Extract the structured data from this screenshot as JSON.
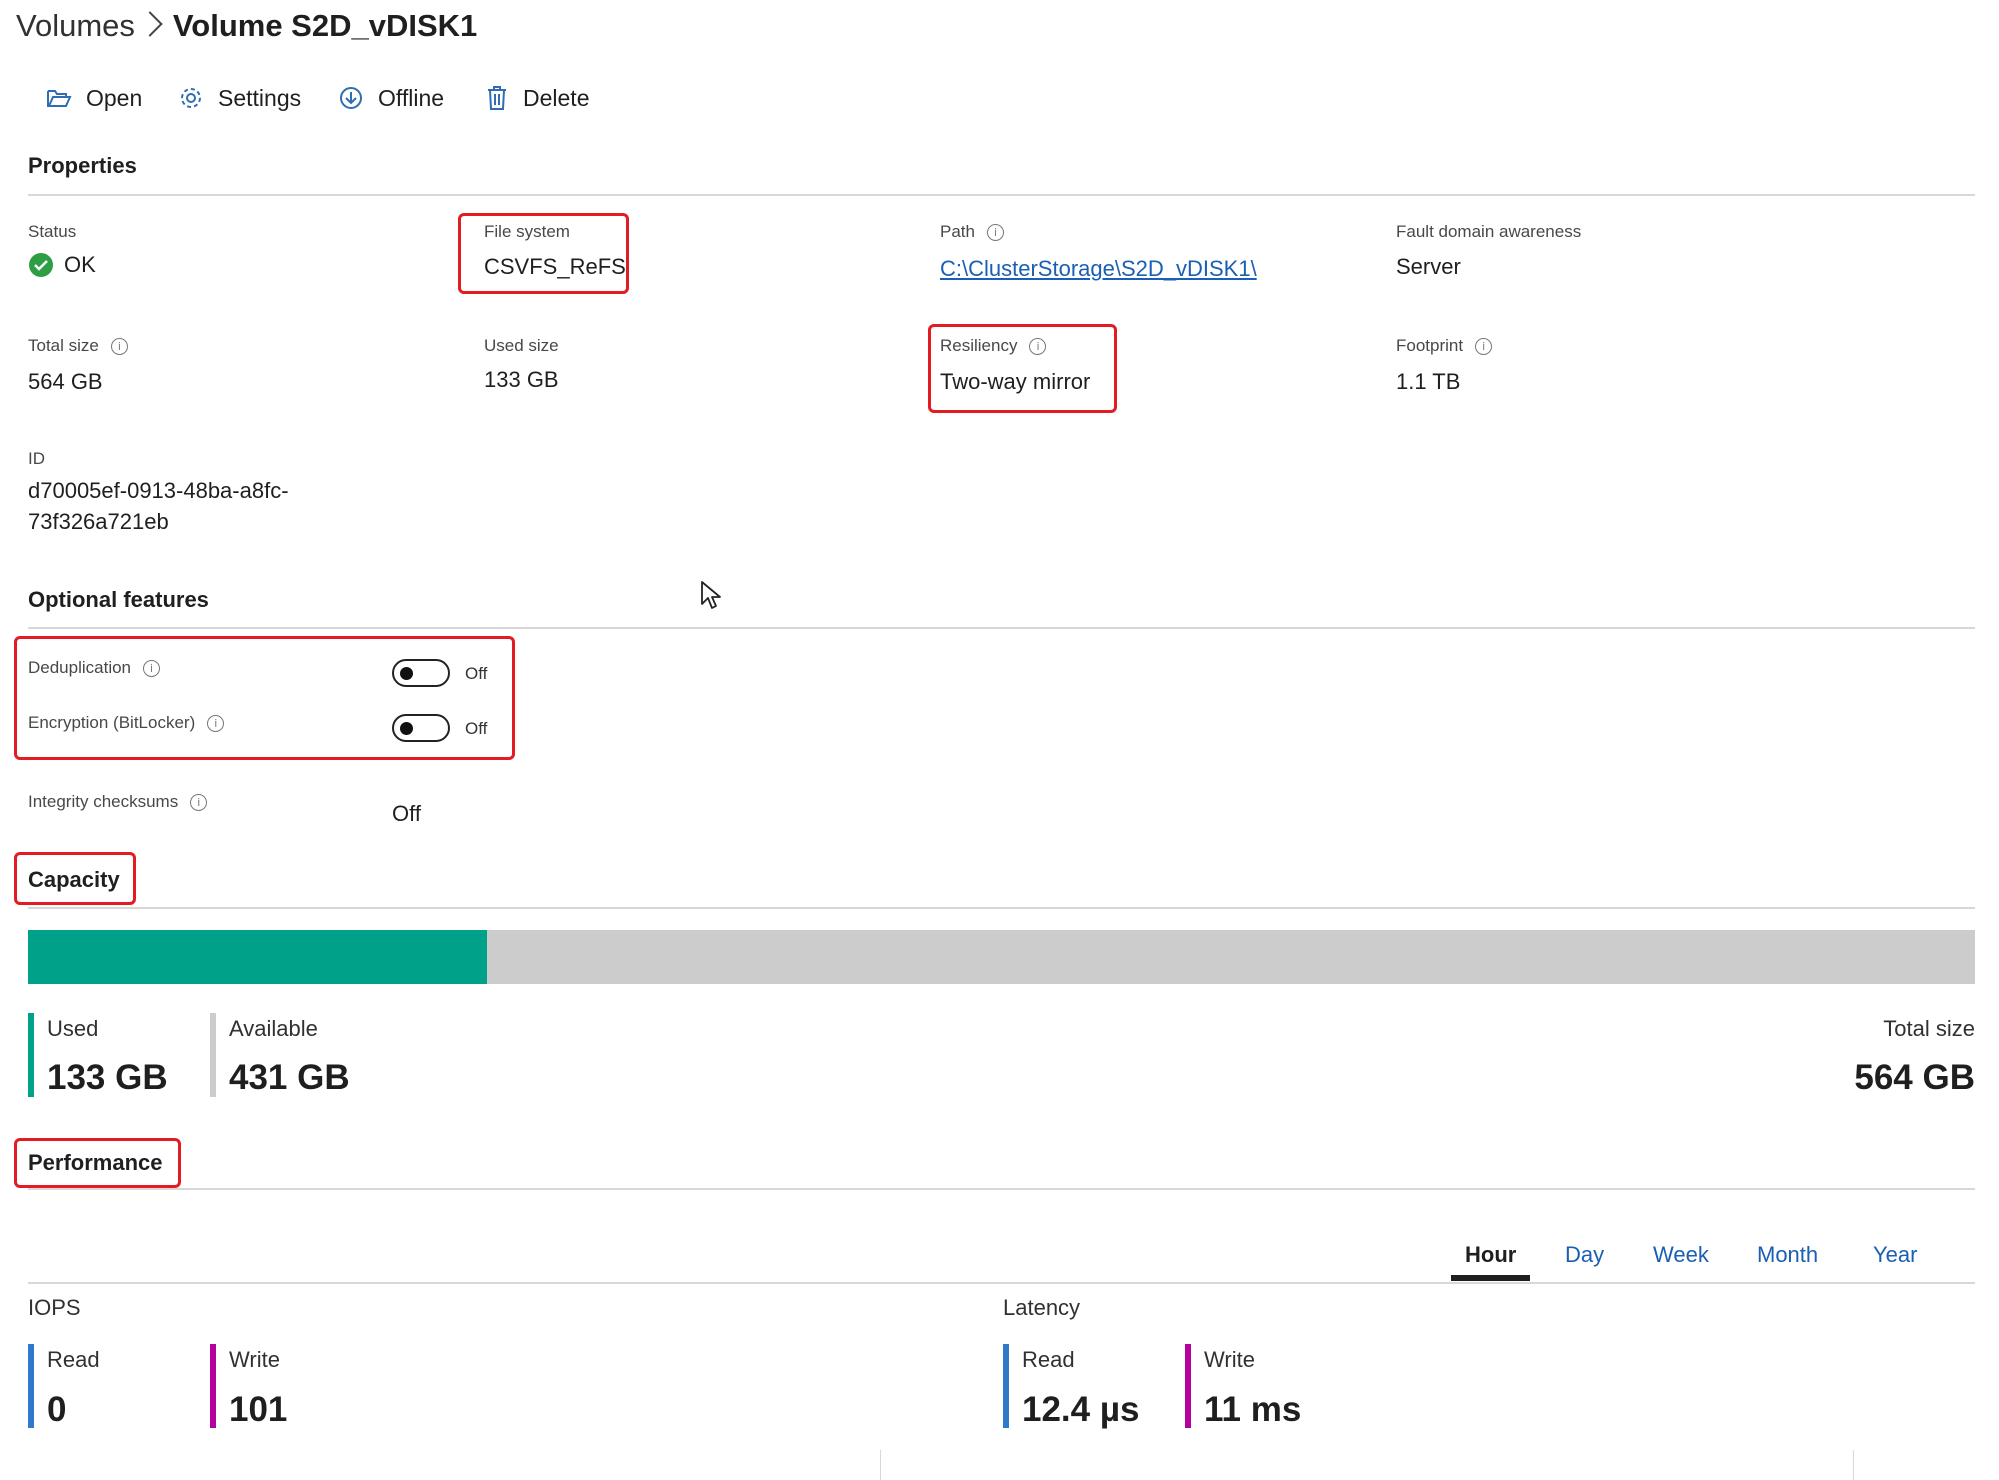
{
  "breadcrumb": {
    "parent": "Volumes",
    "current": "Volume S2D_vDISK1"
  },
  "toolbar": {
    "open": "Open",
    "settings": "Settings",
    "offline": "Offline",
    "delete": "Delete"
  },
  "properties": {
    "heading": "Properties",
    "status": {
      "label": "Status",
      "value": "OK",
      "color": "#2e9e44"
    },
    "file_system": {
      "label": "File system",
      "value": "CSVFS_ReFS"
    },
    "path": {
      "label": "Path",
      "value": "C:\\ClusterStorage\\S2D_vDISK1\\"
    },
    "fault_domain": {
      "label": "Fault domain awareness",
      "value": "Server"
    },
    "total_size": {
      "label": "Total size",
      "value": "564 GB"
    },
    "used_size": {
      "label": "Used size",
      "value": "133 GB"
    },
    "resiliency": {
      "label": "Resiliency",
      "value": "Two-way mirror"
    },
    "footprint": {
      "label": "Footprint",
      "value": "1.1 TB"
    },
    "id": {
      "label": "ID",
      "value_line1": "d70005ef-0913-48ba-a8fc-",
      "value_line2": "73f326a721eb"
    }
  },
  "optional_features": {
    "heading": "Optional features",
    "deduplication": {
      "label": "Deduplication",
      "state": "Off"
    },
    "encryption": {
      "label": "Encryption (BitLocker)",
      "state": "Off"
    },
    "integrity": {
      "label": "Integrity checksums",
      "state": "Off"
    }
  },
  "capacity": {
    "heading": "Capacity",
    "used_fraction": 0.236,
    "used": {
      "label": "Used",
      "value": "133 GB",
      "color": "#00a189"
    },
    "available": {
      "label": "Available",
      "value": "431 GB",
      "color": "#cccccc"
    },
    "total": {
      "label": "Total size",
      "value": "564 GB"
    }
  },
  "performance": {
    "heading": "Performance",
    "tabs": [
      "Hour",
      "Day",
      "Week",
      "Month",
      "Year"
    ],
    "active_tab": "Hour",
    "iops": {
      "title": "IOPS",
      "read_label": "Read",
      "read_value": "0",
      "write_label": "Write",
      "write_value": "101"
    },
    "latency": {
      "title": "Latency",
      "read_label": "Read",
      "read_value": "12.4 µs",
      "write_label": "Write",
      "write_value": "11 ms"
    },
    "read_color": "#2f79c8",
    "write_color": "#b4009e"
  }
}
